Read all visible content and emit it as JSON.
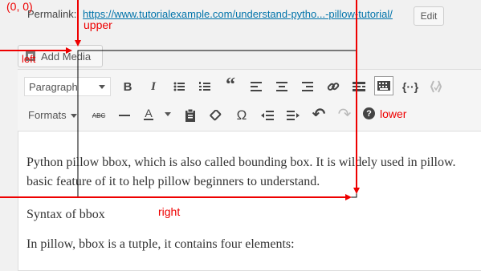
{
  "permalink": {
    "label": "Permalink:",
    "url": "https://www.tutorialexample.com/understand-pytho...-pillow-tutorial/",
    "edit_label": "Edit"
  },
  "media": {
    "add_label": "Add Media"
  },
  "toolbar": {
    "paragraph_label": "Paragraph",
    "formats_label": "Formats",
    "icons": [
      "bold-icon",
      "italic-icon",
      "bullet-list-icon",
      "numbered-list-icon",
      "blockquote-icon",
      "align-left-icon",
      "align-center-icon",
      "align-right-icon",
      "link-icon",
      "read-more-icon",
      "toolbar-toggle-icon",
      "code-icon",
      "spellcheck-icon",
      "strikethrough-icon",
      "horizontal-line-icon",
      "text-color-icon",
      "paste-text-icon",
      "clear-format-icon",
      "omega-icon",
      "outdent-icon",
      "indent-icon",
      "undo-icon",
      "redo-icon",
      "help-icon"
    ],
    "bold_glyph": "B",
    "italic_glyph": "I",
    "quote_glyph": "“",
    "strike_glyph": "ABC",
    "omega_glyph": "Ω",
    "undo_glyph": "↶",
    "redo_glyph": "↷",
    "help_glyph": "?",
    "text_color_glyph": "A"
  },
  "content": {
    "para1_line1": "Python pillow bbox, which is also called bounding box. It is wildely used in pillow.",
    "para1_line2": "basic feature of it to help pillow beginners to understand.",
    "para2": "Syntax of bbox",
    "para3": "In pillow, bbox is a tutple, it contains four elements:"
  },
  "annotations": {
    "origin": "(0, 0)",
    "upper": "upper",
    "left": "left",
    "lower": "lower",
    "right": "right",
    "color": "#e00000"
  }
}
